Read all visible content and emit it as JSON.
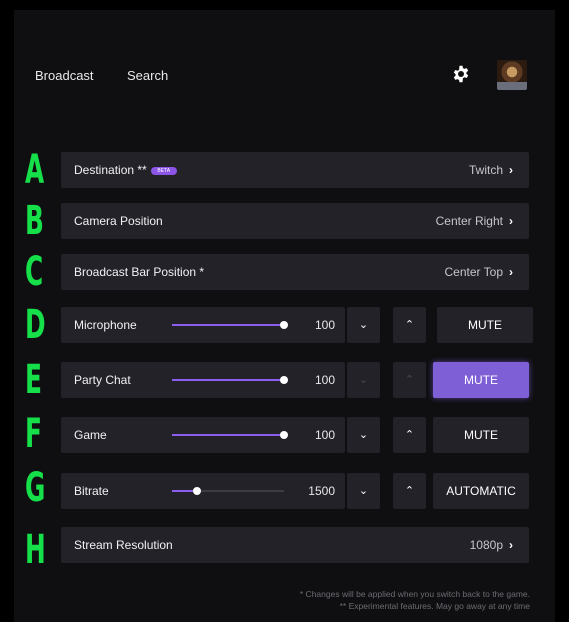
{
  "nav": {
    "broadcast": "Broadcast",
    "search": "Search"
  },
  "icons": {
    "settings": "gear-icon",
    "avatar": "user-avatar"
  },
  "colors": {
    "accent": "#8b5ef0",
    "letters": "#15e04a",
    "panel": "#222228"
  },
  "letters": [
    "A",
    "B",
    "C",
    "D",
    "E",
    "F",
    "G",
    "H"
  ],
  "settings": {
    "destination": {
      "label": "Destination **",
      "badge": "BETA",
      "value": "Twitch"
    },
    "camera_position": {
      "label": "Camera Position",
      "value": "Center Right"
    },
    "broadcast_bar_position": {
      "label": "Broadcast Bar Position *",
      "value": "Center Top"
    },
    "microphone": {
      "label": "Microphone",
      "value": "100",
      "level": 1.0,
      "button": "MUTE"
    },
    "party_chat": {
      "label": "Party Chat",
      "value": "100",
      "level": 1.0,
      "button": "MUTE"
    },
    "game": {
      "label": "Game",
      "value": "100",
      "level": 1.0,
      "button": "MUTE"
    },
    "bitrate": {
      "label": "Bitrate",
      "value": "1500",
      "level": 0.22,
      "button": "AUTOMATIC"
    },
    "stream_resolution": {
      "label": "Stream Resolution",
      "value": "1080p"
    }
  },
  "footer": {
    "line1": "* Changes will be applied when you switch back to the game.",
    "line2": "** Experimental features. May go away at any time"
  }
}
